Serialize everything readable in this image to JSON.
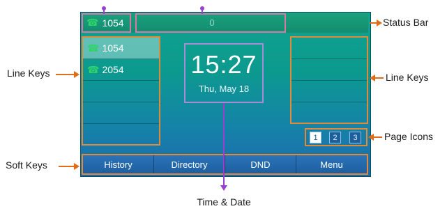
{
  "status_bar": {
    "account_label": "1054",
    "center_indicator": "0",
    "phone_icon": "handset-icon"
  },
  "time": "15:27",
  "date": "Thu, May 18",
  "left_line_keys": [
    {
      "label": "1054",
      "icon": "handset-icon",
      "active": true
    },
    {
      "label": "2054",
      "icon": "handset-icon",
      "active": false
    },
    {
      "label": "",
      "active": false
    },
    {
      "label": "",
      "active": false
    },
    {
      "label": "",
      "active": false
    }
  ],
  "page_icons": [
    "1",
    "2",
    "3"
  ],
  "soft_keys": [
    "History",
    "Directory",
    "DND",
    "Menu"
  ],
  "callouts": {
    "status_bar": "Status Bar",
    "line_keys_left": "Line Keys",
    "line_keys_right": "Line Keys",
    "page_icons": "Page Icons",
    "soft_keys": "Soft Keys",
    "time_date": "Time & Date"
  },
  "colors": {
    "callout_arrow": "#e06c1a",
    "highlight_orange": "#e38a3a",
    "highlight_purple": "#9b3fcf"
  }
}
